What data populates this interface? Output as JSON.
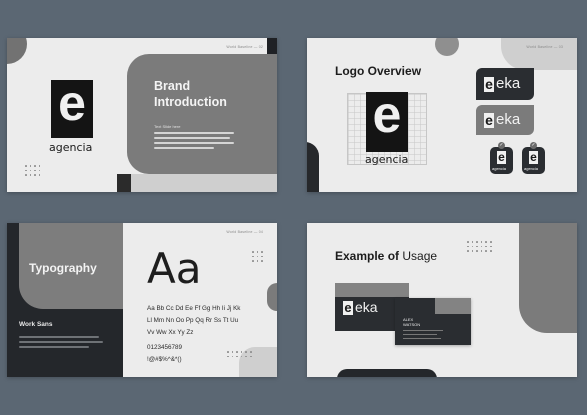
{
  "slides": [
    {
      "superscript": "World Baseline — 02",
      "logo_letter": "e",
      "logo_word": "agencia",
      "title_line1": "Brand",
      "title_line2": "Introduction",
      "subtitle": "Text Slide here"
    },
    {
      "superscript": "World Baseline — 03",
      "title": "Logo Overview",
      "logo_letter": "e",
      "logo_word": "agencia",
      "chip_letter": "e",
      "chip_word": "eka",
      "small_word": "agencia",
      "check_mark": "✓"
    },
    {
      "superscript": "World Baseline — 04",
      "title": "Typography",
      "font_name": "Work Sans",
      "specimen": "Aa",
      "alphabet_line1": "Aa Bb Cc Dd Ee Ff Gg Hh Ii Jj Kk",
      "alphabet_line2": "Ll Mm Nn Oo Pp Qq Rr Ss Tt Uu",
      "alphabet_line3": "Vv Ww Xx Yy Zz",
      "numbers": "0123456789",
      "symbols": "!@#$%^&*()"
    },
    {
      "title_bold": "Example of",
      "title_rest": " Usage",
      "card_letter": "e",
      "card_word": "eka",
      "card_name": "ALEX",
      "card_surname": "WATSON"
    }
  ]
}
